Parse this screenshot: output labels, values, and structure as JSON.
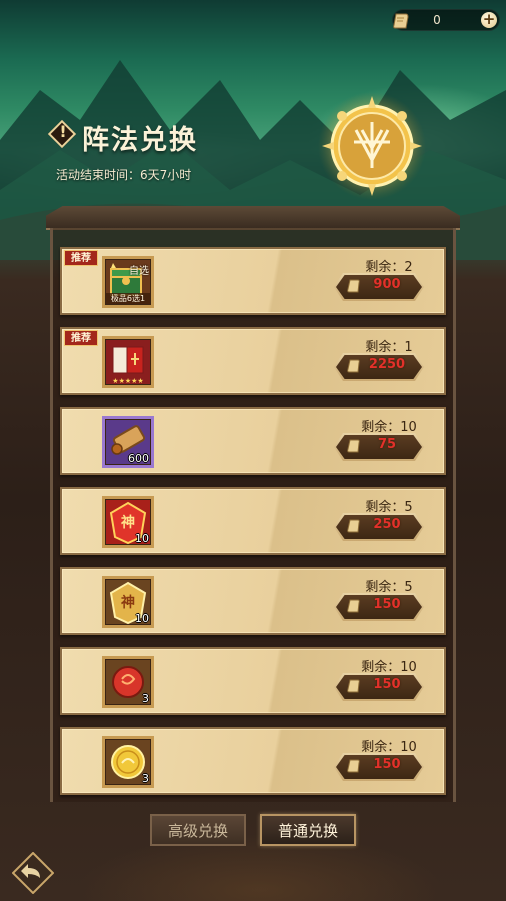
{
  "currency": {
    "value": "0",
    "icon": "scroll-coin-icon",
    "add_icon": "plus-icon"
  },
  "header": {
    "title": "阵法兑换",
    "subtitle": "活动结束时间：6天7小时",
    "emblem_icon": "formation-emblem-icon"
  },
  "rows": [
    {
      "tag": "推荐",
      "item_icon": "treasure-chest-icon",
      "item_lines": [
        "自选",
        "极品6选1"
      ],
      "count": "",
      "remain": "剩余：2",
      "price": "900"
    },
    {
      "tag": "推荐",
      "item_icon": "red-book-icon",
      "item_lines": [],
      "count": "",
      "remain": "剩余：1",
      "price": "2250"
    },
    {
      "tag": "",
      "item_icon": "scroll-bundle-icon",
      "item_lines": [],
      "count": "600",
      "remain": "剩余：10",
      "price": "75"
    },
    {
      "tag": "",
      "item_icon": "red-god-token-icon",
      "item_lines": [
        "神"
      ],
      "count": "10",
      "remain": "剩余：5",
      "price": "250"
    },
    {
      "tag": "",
      "item_icon": "gold-god-token-icon",
      "item_lines": [
        "神"
      ],
      "count": "10",
      "remain": "剩余：5",
      "price": "150"
    },
    {
      "tag": "",
      "item_icon": "red-orb-icon",
      "item_lines": [],
      "count": "3",
      "remain": "剩余：10",
      "price": "150"
    },
    {
      "tag": "",
      "item_icon": "gold-coin-icon",
      "item_lines": [],
      "count": "3",
      "remain": "剩余：10",
      "price": "150"
    }
  ],
  "tabs": {
    "advanced": "高级兑换",
    "normal": "普通兑换"
  },
  "back_icon": "back-arrow-icon",
  "colors": {
    "price_text": "#e2312a",
    "tag_bg": "#a3271b",
    "panel_bg": "#f0dcae"
  }
}
